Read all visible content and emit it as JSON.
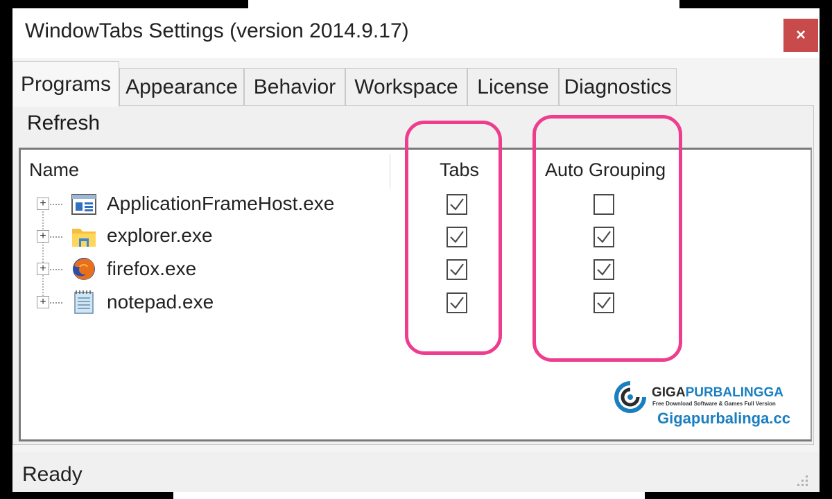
{
  "window": {
    "title": "WindowTabs Settings (version 2014.9.17)",
    "close_label": "×"
  },
  "tabs": [
    "Programs",
    "Appearance",
    "Behavior",
    "Workspace",
    "License",
    "Diagnostics"
  ],
  "active_tab": "Programs",
  "toolbar": {
    "refresh_label": "Refresh"
  },
  "list": {
    "columns": {
      "name": "Name",
      "tabs": "Tabs",
      "auto_grouping": "Auto Grouping"
    },
    "rows": [
      {
        "name": "ApplicationFrameHost.exe",
        "icon": "app-frame-icon",
        "tabs": true,
        "auto_grouping": false
      },
      {
        "name": "explorer.exe",
        "icon": "folder-icon",
        "tabs": true,
        "auto_grouping": true
      },
      {
        "name": "firefox.exe",
        "icon": "firefox-icon",
        "tabs": true,
        "auto_grouping": true
      },
      {
        "name": "notepad.exe",
        "icon": "notepad-icon",
        "tabs": true,
        "auto_grouping": true
      }
    ]
  },
  "status": {
    "text": "Ready"
  },
  "watermark": {
    "brand_left": "GIGA",
    "brand_right": "PURBALINGGA",
    "tagline": "Free Download Software & Games Full Version",
    "url": "Gigapurbalinga.cc"
  },
  "colors": {
    "highlight": "#ee3d8f",
    "close_button": "#c94a4a",
    "watermark_blue": "#1a7fc0"
  }
}
